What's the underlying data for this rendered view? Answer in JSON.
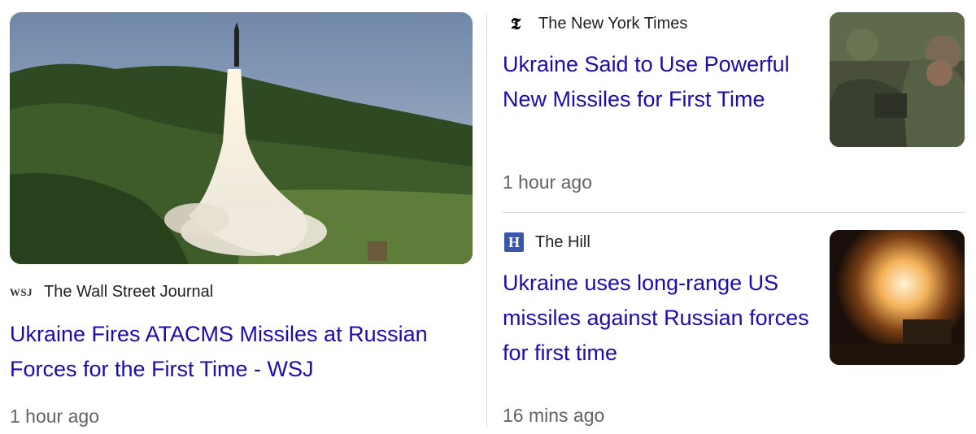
{
  "main_story": {
    "source": "The Wall Street Journal",
    "source_logo": "WSJ",
    "headline": "Ukraine Fires ATACMS Missiles at Russian Forces for the First Time - WSJ",
    "time": "1 hour ago",
    "image_icon": "missile-launch-photo"
  },
  "side_stories": [
    {
      "source": "The New York Times",
      "source_logo": "𝕿",
      "headline": "Ukraine Said to Use Powerful New Missiles for First Time",
      "time": "1 hour ago",
      "image_icon": "soldiers-photo"
    },
    {
      "source": "The Hill",
      "source_logo": "H",
      "headline": "Ukraine uses long-range US missiles against Russian forces for first time",
      "time": "16 mins ago",
      "image_icon": "night-launch-photo"
    }
  ],
  "colors": {
    "headline": "#1a0dab",
    "meta": "#5f6368",
    "hill_logo_bg": "#3b56a8"
  }
}
